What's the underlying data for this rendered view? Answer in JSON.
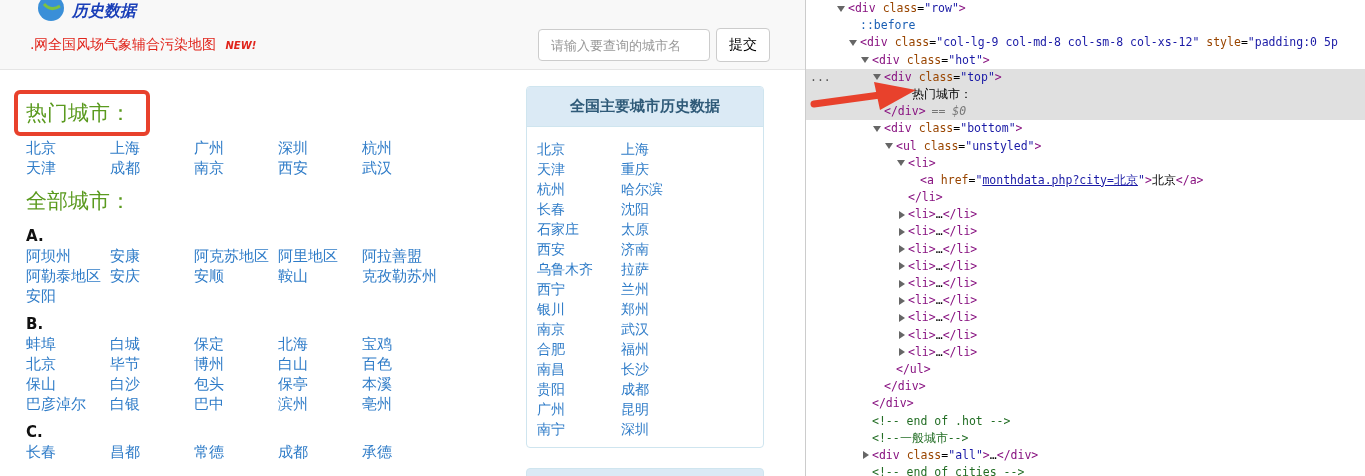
{
  "header": {
    "logo_text": "历史数据",
    "banner": {
      "text": ".网全国风场气象辅合污染地图",
      "badge": "NEW!"
    },
    "search": {
      "placeholder": "请输入要查询的城市名"
    },
    "submit": "提交"
  },
  "hot": {
    "title": "热门城市：",
    "cities": [
      "北京",
      "上海",
      "广州",
      "深圳",
      "杭州",
      "天津",
      "成都",
      "南京",
      "西安",
      "武汉"
    ]
  },
  "all": {
    "title": "全部城市：",
    "groups": [
      {
        "letter": "A.",
        "cities": [
          "阿坝州",
          "安康",
          "阿克苏地区",
          "阿里地区",
          "阿拉善盟",
          "阿勒泰地区",
          "安庆",
          "安顺",
          "鞍山",
          "克孜勒苏州",
          "安阳"
        ]
      },
      {
        "letter": "B.",
        "cities": [
          "蚌埠",
          "白城",
          "保定",
          "北海",
          "宝鸡",
          "北京",
          "毕节",
          "博州",
          "白山",
          "百色",
          "保山",
          "白沙",
          "包头",
          "保亭",
          "本溪",
          "巴彦淖尔",
          "白银",
          "巴中",
          "滨州",
          "亳州"
        ]
      },
      {
        "letter": "C.",
        "cities": [
          "长春",
          "昌都",
          "常德",
          "成都",
          "承德"
        ]
      }
    ]
  },
  "sidebar": {
    "title": "全国主要城市历史数据",
    "cities": [
      "北京",
      "上海",
      "天津",
      "重庆",
      "杭州",
      "哈尔滨",
      "长春",
      "沈阳",
      "石家庄",
      "太原",
      "西安",
      "济南",
      "乌鲁木齐",
      "拉萨",
      "西宁",
      "兰州",
      "银川",
      "郑州",
      "南京",
      "武汉",
      "合肥",
      "福州",
      "南昌",
      "长沙",
      "贵阳",
      "成都",
      "广州",
      "昆明",
      "南宁",
      "深圳"
    ]
  },
  "devtools": {
    "nodes": [
      {
        "kind": "element",
        "text": "<div class=\"row\">",
        "expanded": true,
        "selected": false,
        "children": [
          {
            "kind": "pseudo",
            "text": "::before"
          },
          {
            "kind": "element",
            "text": "<div class=\"col-lg-9 col-md-8 col-sm-8 col-xs-12\" style=\"padding:0 5p",
            "expanded": true,
            "selected": false,
            "children": [
              {
                "kind": "element",
                "text": "<div class=\"hot\">",
                "expanded": true,
                "selected": false,
                "close": "</div>",
                "children": [
                  {
                    "kind": "element",
                    "text": "<div class=\"top\">",
                    "expanded": true,
                    "selected": true,
                    "gutter": "...",
                    "close": "</div>",
                    "close_note": "== $0",
                    "children": [
                      {
                        "kind": "text",
                        "text": "热门城市："
                      }
                    ]
                  },
                  {
                    "kind": "element",
                    "text": "<div class=\"bottom\">",
                    "expanded": true,
                    "selected": false,
                    "close": "</div>",
                    "children": [
                      {
                        "kind": "element",
                        "text": "<ul class=\"unstyled\">",
                        "expanded": true,
                        "selected": false,
                        "close": "</ul>",
                        "children": [
                          {
                            "kind": "element",
                            "text": "<li>",
                            "expanded": true,
                            "selected": false,
                            "close": "</li>",
                            "children": [
                              {
                                "kind": "element",
                                "text": "<a href=\"monthdata.php?city=北京\">北京</a>",
                                "selected": false,
                                "link": true
                              }
                            ]
                          },
                          {
                            "kind": "element",
                            "text": "<li>…</li>",
                            "expanded": false,
                            "selected": false
                          },
                          {
                            "kind": "element",
                            "text": "<li>…</li>",
                            "expanded": false,
                            "selected": false
                          },
                          {
                            "kind": "element",
                            "text": "<li>…</li>",
                            "expanded": false,
                            "selected": false
                          },
                          {
                            "kind": "element",
                            "text": "<li>…</li>",
                            "expanded": false,
                            "selected": false
                          },
                          {
                            "kind": "element",
                            "text": "<li>…</li>",
                            "expanded": false,
                            "selected": false
                          },
                          {
                            "kind": "element",
                            "text": "<li>…</li>",
                            "expanded": false,
                            "selected": false
                          },
                          {
                            "kind": "element",
                            "text": "<li>…</li>",
                            "expanded": false,
                            "selected": false
                          },
                          {
                            "kind": "element",
                            "text": "<li>…</li>",
                            "expanded": false,
                            "selected": false
                          },
                          {
                            "kind": "element",
                            "text": "<li>…</li>",
                            "expanded": false,
                            "selected": false
                          }
                        ]
                      }
                    ]
                  }
                ]
              },
              {
                "kind": "comment",
                "text": "<!-- end of .hot -->"
              },
              {
                "kind": "comment",
                "text": "<!--一般城市-->"
              },
              {
                "kind": "element",
                "text": "<div class=\"all\">…</div>",
                "expanded": false,
                "selected": false
              },
              {
                "kind": "comment",
                "text": "<!-- end of cities -->"
              }
            ]
          }
        ]
      }
    ]
  }
}
